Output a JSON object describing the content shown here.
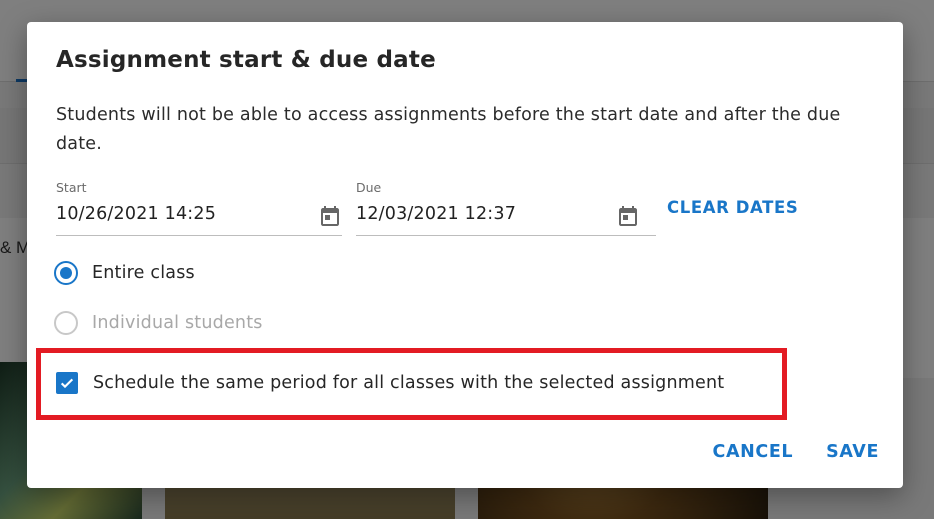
{
  "background": {
    "cut_text": "& M"
  },
  "dialog": {
    "title": "Assignment start & due date",
    "description": "Students will not be able to access assignments before the start date and after the due date.",
    "start": {
      "label": "Start",
      "value": "10/26/2021 14:25",
      "icon": "calendar-icon"
    },
    "due": {
      "label": "Due",
      "value": "12/03/2021 12:37",
      "icon": "calendar-icon"
    },
    "clear_dates_label": "CLEAR DATES",
    "audience_options": [
      {
        "label": "Entire class",
        "selected": true,
        "disabled": false
      },
      {
        "label": "Individual students",
        "selected": false,
        "disabled": true
      }
    ],
    "schedule_checkbox": {
      "label": "Schedule the same period for all classes with the selected assignment",
      "checked": true
    },
    "cancel_label": "CANCEL",
    "save_label": "SAVE"
  },
  "colors": {
    "accent": "#1976c8",
    "highlight": "#e31b23"
  }
}
